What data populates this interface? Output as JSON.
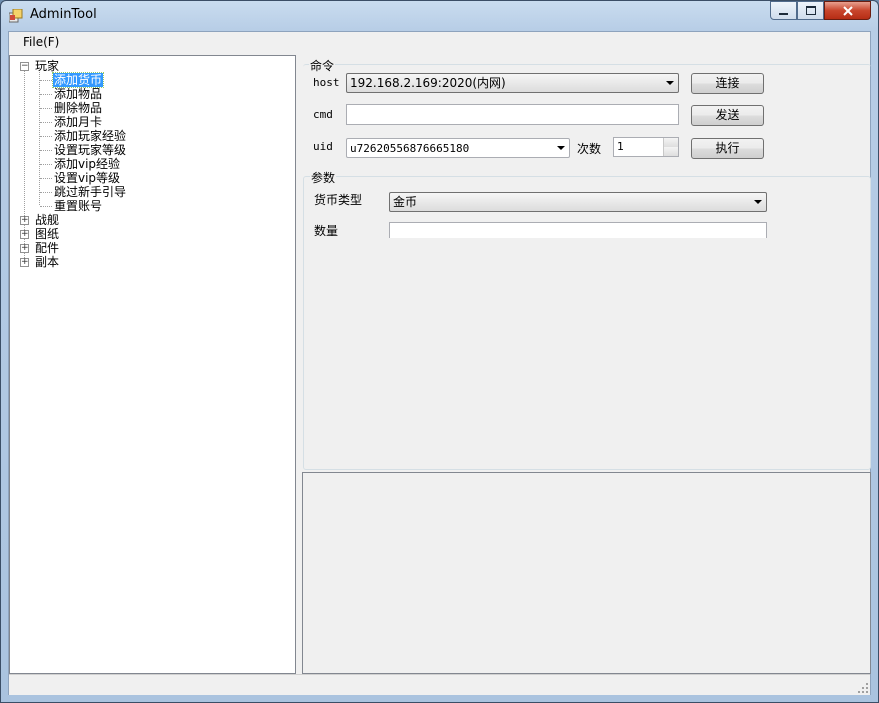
{
  "window": {
    "title": "AdminTool"
  },
  "menu": {
    "file_label": "File(F)"
  },
  "tree": {
    "expanded_root": "玩家",
    "children": [
      "添加货币",
      "添加物品",
      "删除物品",
      "添加月卡",
      "添加玩家经验",
      "设置玩家等级",
      "添加vip经验",
      "设置vip等级",
      "跳过新手引导",
      "重置账号"
    ],
    "selected": "添加货币",
    "collapsed_roots": [
      "战舰",
      "图纸",
      "配件",
      "副本"
    ]
  },
  "command_group": {
    "title": "命令",
    "host_label": "host",
    "host_value": "192.168.2.169:2020(内网)",
    "cmd_label": "cmd",
    "cmd_value": "",
    "uid_label": "uid",
    "uid_value": "u72620556876665180",
    "count_label": "次数",
    "count_value": "1",
    "connect_button": "连接",
    "send_button": "发送",
    "execute_button": "执行"
  },
  "params_group": {
    "title": "参数",
    "currency_type_label": "货币类型",
    "currency_type_value": "金币",
    "amount_label": "数量",
    "amount_value": ""
  },
  "icons": {
    "app": "app-window-icon",
    "minimize": "minimize-icon",
    "maximize": "maximize-icon",
    "close": "close-icon",
    "expand": "expand-plus-icon",
    "collapse": "collapse-minus-icon",
    "dropdown": "dropdown-arrow-icon",
    "size_grip": "size-grip-icon"
  }
}
